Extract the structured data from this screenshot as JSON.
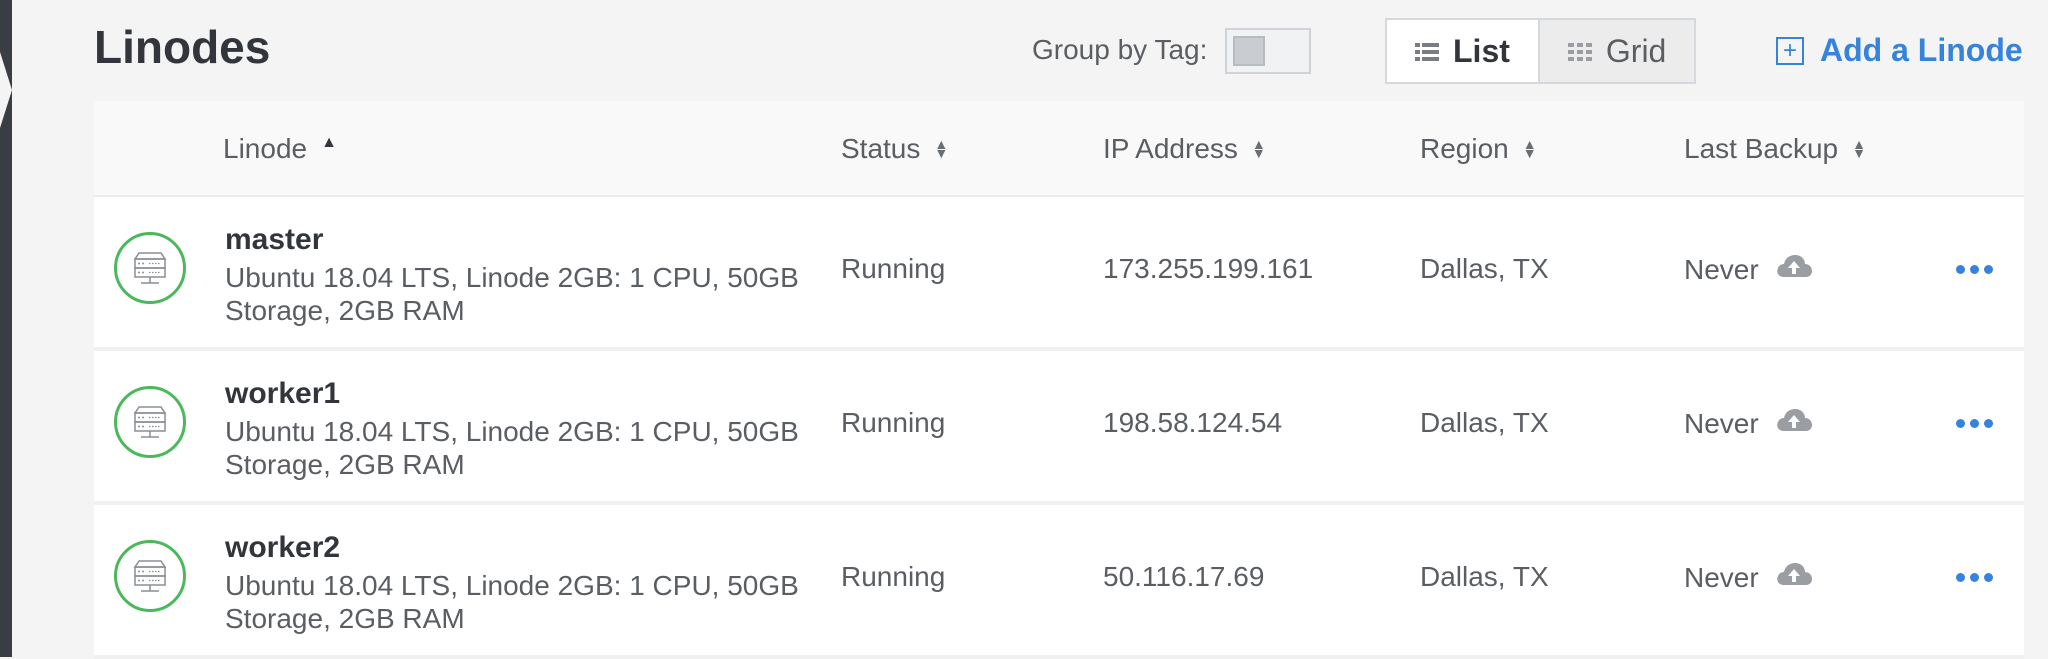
{
  "page": {
    "title": "Linodes",
    "group_by_label": "Group by Tag:",
    "view_list_label": "List",
    "view_grid_label": "Grid",
    "add_label": "Add a Linode",
    "accent_color": "#3683dc",
    "status_ring_color": "#4bb85c"
  },
  "table": {
    "columns": [
      "Linode",
      "Status",
      "IP Address",
      "Region",
      "Last Backup"
    ],
    "rows": [
      {
        "name": "master",
        "description": "Ubuntu 18.04 LTS, Linode 2GB: 1 CPU, 50GB Storage, 2GB RAM",
        "status": "Running",
        "ip": "173.255.199.161",
        "region": "Dallas, TX",
        "last_backup": "Never"
      },
      {
        "name": "worker1",
        "description": "Ubuntu 18.04 LTS, Linode 2GB: 1 CPU, 50GB Storage, 2GB RAM",
        "status": "Running",
        "ip": "198.58.124.54",
        "region": "Dallas, TX",
        "last_backup": "Never"
      },
      {
        "name": "worker2",
        "description": "Ubuntu 18.04 LTS, Linode 2GB: 1 CPU, 50GB Storage, 2GB RAM",
        "status": "Running",
        "ip": "50.116.17.69",
        "region": "Dallas, TX",
        "last_backup": "Never"
      }
    ]
  },
  "icons": {
    "list": "list-icon",
    "grid": "grid-icon",
    "add": "plus-box-icon",
    "server": "server-icon",
    "backup": "cloud-upload-icon",
    "more": "more-actions-icon",
    "sort_asc": "sort-ascending-icon",
    "sort": "sort-icon"
  }
}
